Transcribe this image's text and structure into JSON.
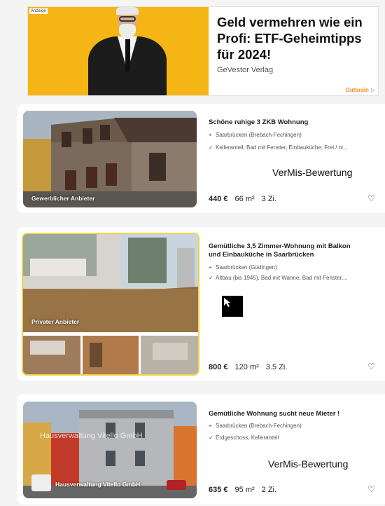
{
  "ad": {
    "label": "Anzeige",
    "title": "Geld vermehren wie ein Profi: ETF-Geheimtipps für 2024!",
    "source": "GeVestor Verlag",
    "brand": "Outbrain"
  },
  "listings": [
    {
      "badge": "Gewerblicher Anbieter",
      "title": "Schöne ruhige 3 ZKB Wohnung",
      "location": "Saarbrücken (Brebach-Fechingen)",
      "features": "Kelleranteil, Bad mit Fenster, Einbauküche, Frei / ni...",
      "price": "440 €",
      "area": "66 m²",
      "rooms": "3 Zi.",
      "overlay": "VerMis-Bewertung"
    },
    {
      "badge": "Privater Anbieter",
      "title": "Gemütliche 3,5 Zimmer-Wohnung mit Balkon und Einbauküche in Saarbrücken",
      "location": "Saarbrücken (Güdingen)",
      "features": "Altbau (bis 1945), Bad mit Wanne, Bad mit Fenster,...",
      "price": "800 €",
      "area": "120 m²",
      "rooms": "3.5 Zi."
    },
    {
      "badge": "Hausverwaltung Vitello GmbH",
      "watermark": "Hausverwaltung Vitello GmbH",
      "title": "Gemütliche Wohnung sucht neue Mieter !",
      "location": "Saarbrücken (Brebach-Fechingen)",
      "features": "Erdgeschoss, Kelleranteil",
      "price": "635 €",
      "area": "95 m²",
      "rooms": "2 Zi.",
      "overlay": "VerMis-Bewertung"
    }
  ],
  "icons": {
    "location": "location-pin-icon",
    "check": "check-icon",
    "favorite": "heart-icon"
  }
}
